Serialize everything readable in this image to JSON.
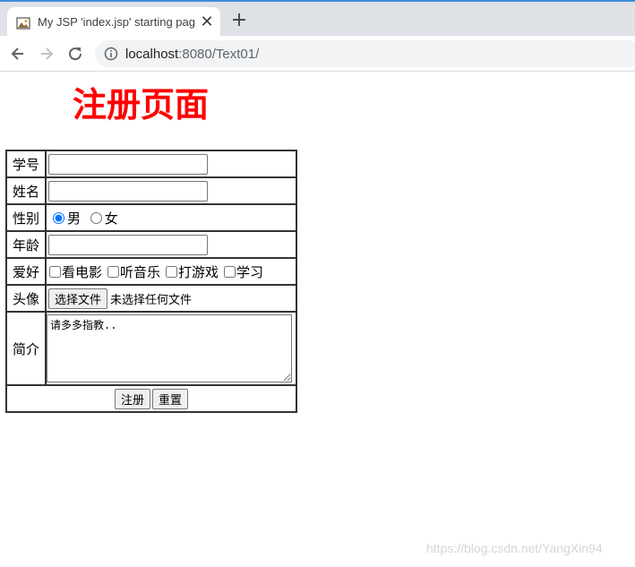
{
  "browser": {
    "tab_title": "My JSP 'index.jsp' starting page",
    "close_glyph": "✕",
    "new_tab_glyph": "+",
    "url_host": "localhost",
    "url_rest": ":8080/Text01/"
  },
  "page": {
    "title": "注册页面",
    "title_color": "#ff0000"
  },
  "form": {
    "student_id_label": "学号",
    "student_id_value": "",
    "name_label": "姓名",
    "name_value": "",
    "gender_label": "性别",
    "gender_options": [
      "男",
      "女"
    ],
    "gender_selected": "男",
    "age_label": "年龄",
    "age_value": "",
    "hobby_label": "爱好",
    "hobbies": [
      "看电影",
      "听音乐",
      "打游戏",
      "学习"
    ],
    "avatar_label": "头像",
    "file_button": "选择文件",
    "file_status": "未选择任何文件",
    "intro_label": "简介",
    "intro_value": "请多多指教..",
    "submit_button": "注册",
    "reset_button": "重置"
  },
  "watermark": "https://blog.csdn.net/YangXin94"
}
